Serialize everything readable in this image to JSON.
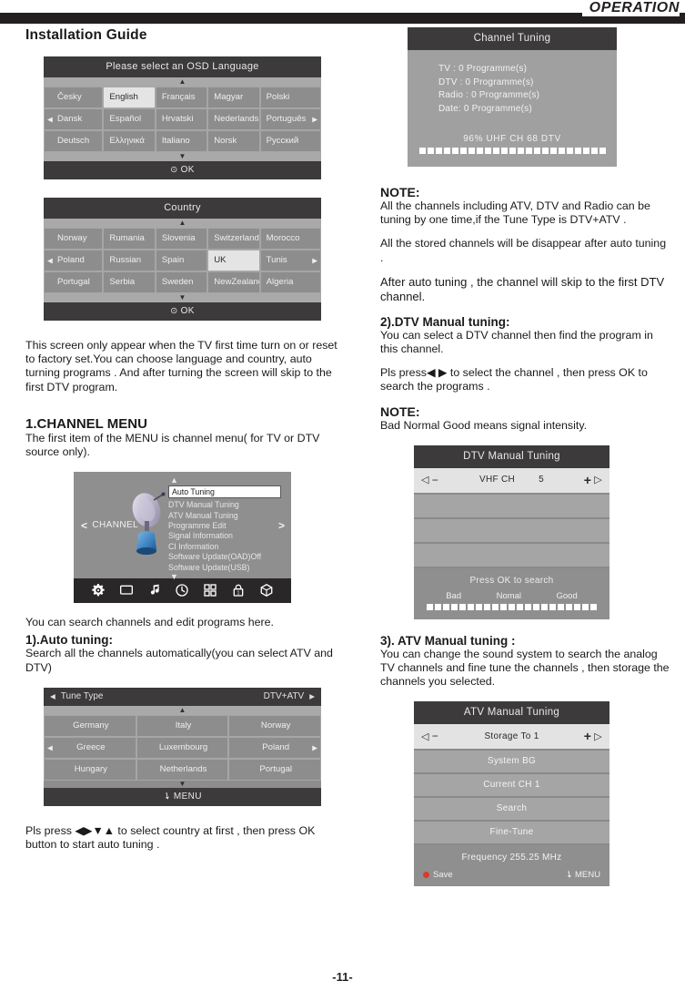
{
  "header": {
    "title": "OPERATION"
  },
  "footer": {
    "page_number": "-11-"
  },
  "left": {
    "section_title": "Installation Guide",
    "language_osd": {
      "title": "Please select an OSD Language",
      "rows": [
        [
          "Česky",
          "English",
          "Français",
          "Magyar",
          "Polski"
        ],
        [
          "Dansk",
          "Español",
          "Hrvatski",
          "Nederlands",
          "Português"
        ],
        [
          "Deutsch",
          "Ελληνικά",
          "Italiano",
          "Norsk",
          "Русский"
        ]
      ],
      "selected": "English",
      "ok_label": "OK"
    },
    "country_osd": {
      "title": "Country",
      "rows": [
        [
          "Norway",
          "Rumania",
          "Slovenia",
          "Switzerland",
          "Morocco"
        ],
        [
          "Poland",
          "Russian",
          "Spain",
          "UK",
          "Tunis"
        ],
        [
          "Portugal",
          "Serbia",
          "Sweden",
          "NewZealand",
          "Algeria"
        ]
      ],
      "selected": "UK",
      "ok_label": "OK"
    },
    "intro_paragraph": "This screen only appear when the TV first time turn on or reset to factory set.You can choose language and country, auto turning programs . And after turning the screen will  skip to the first DTV program.",
    "channel_menu_heading": "1.CHANNEL MENU",
    "channel_menu_desc": "The first item of the MENU is channel menu( for TV or DTV source only).",
    "channel_menu_osd": {
      "left_label": "CHANNEL",
      "left_arrow": "<",
      "right_arrow": ">",
      "items": [
        "Auto Tuning",
        "DTV Manual Tuning",
        "ATV Manual Tuning",
        "Programme Edit",
        "Signal Information",
        "CI Information",
        "Software Update(OAD)Off",
        "Software Update(USB)"
      ],
      "selected": "Auto Tuning",
      "icons": [
        "gear-icon",
        "screen-icon",
        "music-note-icon",
        "clock-icon",
        "grid-icon",
        "lock-icon",
        "cube-icon"
      ]
    },
    "search_note": "You can search  channels and edit programs  here.",
    "auto_tuning_heading": "1).Auto tuning:",
    "auto_tuning_desc": "Search all the channels automatically(you can select ATV and DTV)",
    "tune_type_osd": {
      "label": "Tune Type",
      "value": "DTV+ATV",
      "rows": [
        [
          "Germany",
          "Italy",
          "Norway"
        ],
        [
          "Greece",
          "Luxembourg",
          "Poland"
        ],
        [
          "Hungary",
          "Netherlands",
          "Portugal"
        ]
      ],
      "selected": "Greece",
      "menu_label": "MENU"
    },
    "closing_paragraph": "Pls press ◀▶▼▲ to select  country at first , then press OK button to start auto tuning ."
  },
  "right": {
    "channel_tuning_panel": {
      "title": "Channel Tuning",
      "lines": [
        "TV   : 0 Programme(s)",
        "DTV : 0 Programme(s)",
        "Radio : 0 Programme(s)",
        "Date:  0 Programme(s)"
      ],
      "status": "96%   UHF   CH   68 DTV",
      "progress_percent": 96,
      "progress_blocks": 23
    },
    "note1_heading": "NOTE:",
    "note1_body": "All the channels including ATV,  DTV and Radio can be tuning by one time,if the Tune Type is DTV+ATV .",
    "note1_body2": "All the stored channels will be disappear after auto tuning .",
    "note1_body3": "After auto tuning , the channel will skip to the first DTV channel.",
    "dtv_heading": "2).DTV Manual tuning:",
    "dtv_desc": "You can select a DTV channel then  find the program in this channel.",
    "dtv_press": "Pls press◀ ▶ to select the channel , then press OK to search the programs .",
    "note2_heading": "NOTE:",
    "note2_body": "Bad Normal Good means signal intensity.",
    "dtv_panel": {
      "title": "DTV Manual Tuning",
      "row_label": "VHF CH",
      "row_value": "5",
      "minus": "−",
      "plus": "+",
      "left_tri": "◁",
      "right_tri": "▷",
      "blank_rows": 3,
      "footer": "Press OK to search",
      "signal_labels": [
        "Bad",
        "Nomal",
        "Good"
      ],
      "signal_blocks": 21
    },
    "atv_heading": "3). ATV  Manual tuning :",
    "atv_desc": "You can change the sound system to search the analog TV channels and fine tune the channels , then storage the channels you selected.",
    "atv_panel": {
      "title": "ATV Manual Tuning",
      "row_label": "Storage To 1",
      "minus": "−",
      "plus": "+",
      "left_tri": "◁",
      "right_tri": "▷",
      "rows": [
        "System BG",
        "Current CH 1",
        "Search",
        "Fine-Tune"
      ],
      "frequency": "Frequency  255.25  MHz",
      "save_label": "Save",
      "menu_label": "MENU"
    }
  }
}
